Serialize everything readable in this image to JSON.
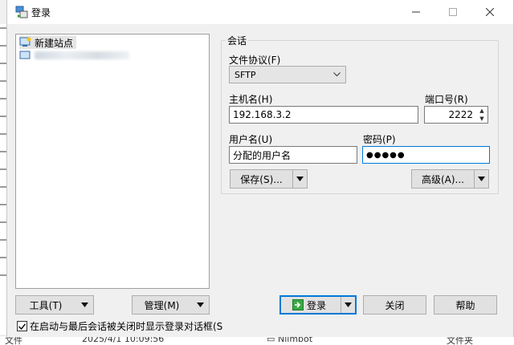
{
  "window": {
    "title": "登录"
  },
  "site_tree": {
    "items": [
      {
        "label": "新建站点",
        "selected": true
      }
    ]
  },
  "session": {
    "group_title": "会话",
    "protocol_label": "文件协议(F)",
    "protocol_value": "SFTP",
    "host_label": "主机名(H)",
    "host_value": "192.168.3.2",
    "port_label": "端口号(R)",
    "port_value": "2222",
    "user_label": "用户名(U)",
    "user_value": "分配的用户名",
    "password_label": "密码(P)",
    "password_value": "●●●●●",
    "save_label": "保存(S)...",
    "advanced_label": "高级(A)..."
  },
  "bottom": {
    "tools_label": "工具(T)",
    "manage_label": "管理(M)",
    "login_label": "登录",
    "close_label": "关闭",
    "help_label": "帮助",
    "checkbox_label": "在启动与最后会话被关闭时显示登录对话框(S",
    "checkbox_checked": true
  },
  "background": {
    "date_text": "2025/4/1 10:09:56",
    "file_name": "Nlimbot",
    "file_type": "文件夹",
    "left_text": "文件"
  },
  "colors": {
    "accent": "#0078d7",
    "window_bg": "#f0f0f0"
  }
}
